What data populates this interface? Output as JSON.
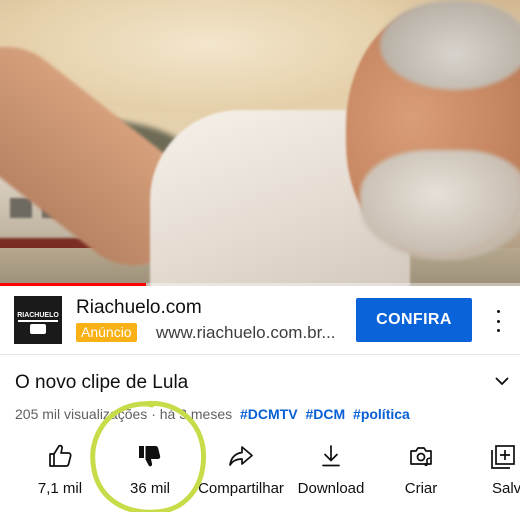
{
  "ad": {
    "advertiser": "Riachuelo.com",
    "badge": "Anúncio",
    "url": "www.riachuelo.com.br...",
    "cta": "CONFIRA",
    "logo_text": "RIACHUELO"
  },
  "video": {
    "title": "O novo clipe de Lula",
    "views": "205 mil visualizações",
    "age": "· há 3 meses",
    "hashtags": [
      "#DCMTV",
      "#DCM",
      "#política"
    ],
    "progress_fraction": 0.28
  },
  "actions": [
    {
      "name": "like",
      "label": "7,1 mil",
      "icon": "thumb-up-icon"
    },
    {
      "name": "dislike",
      "label": "36 mil",
      "icon": "thumb-down-filled-icon"
    },
    {
      "name": "share",
      "label": "Compartilhar",
      "icon": "share-arrow-icon"
    },
    {
      "name": "download",
      "label": "Download",
      "icon": "download-icon"
    },
    {
      "name": "create",
      "label": "Criar",
      "icon": "create-camera-icon"
    },
    {
      "name": "save",
      "label": "Salvar",
      "icon": "playlist-add-icon"
    }
  ],
  "colors": {
    "cta_blue": "#0a63d9",
    "badge_yellow": "#f9b116",
    "hashtag_blue": "#065fd4",
    "annotation_green": "#c8dc4a",
    "progress_red": "#ff0000"
  }
}
